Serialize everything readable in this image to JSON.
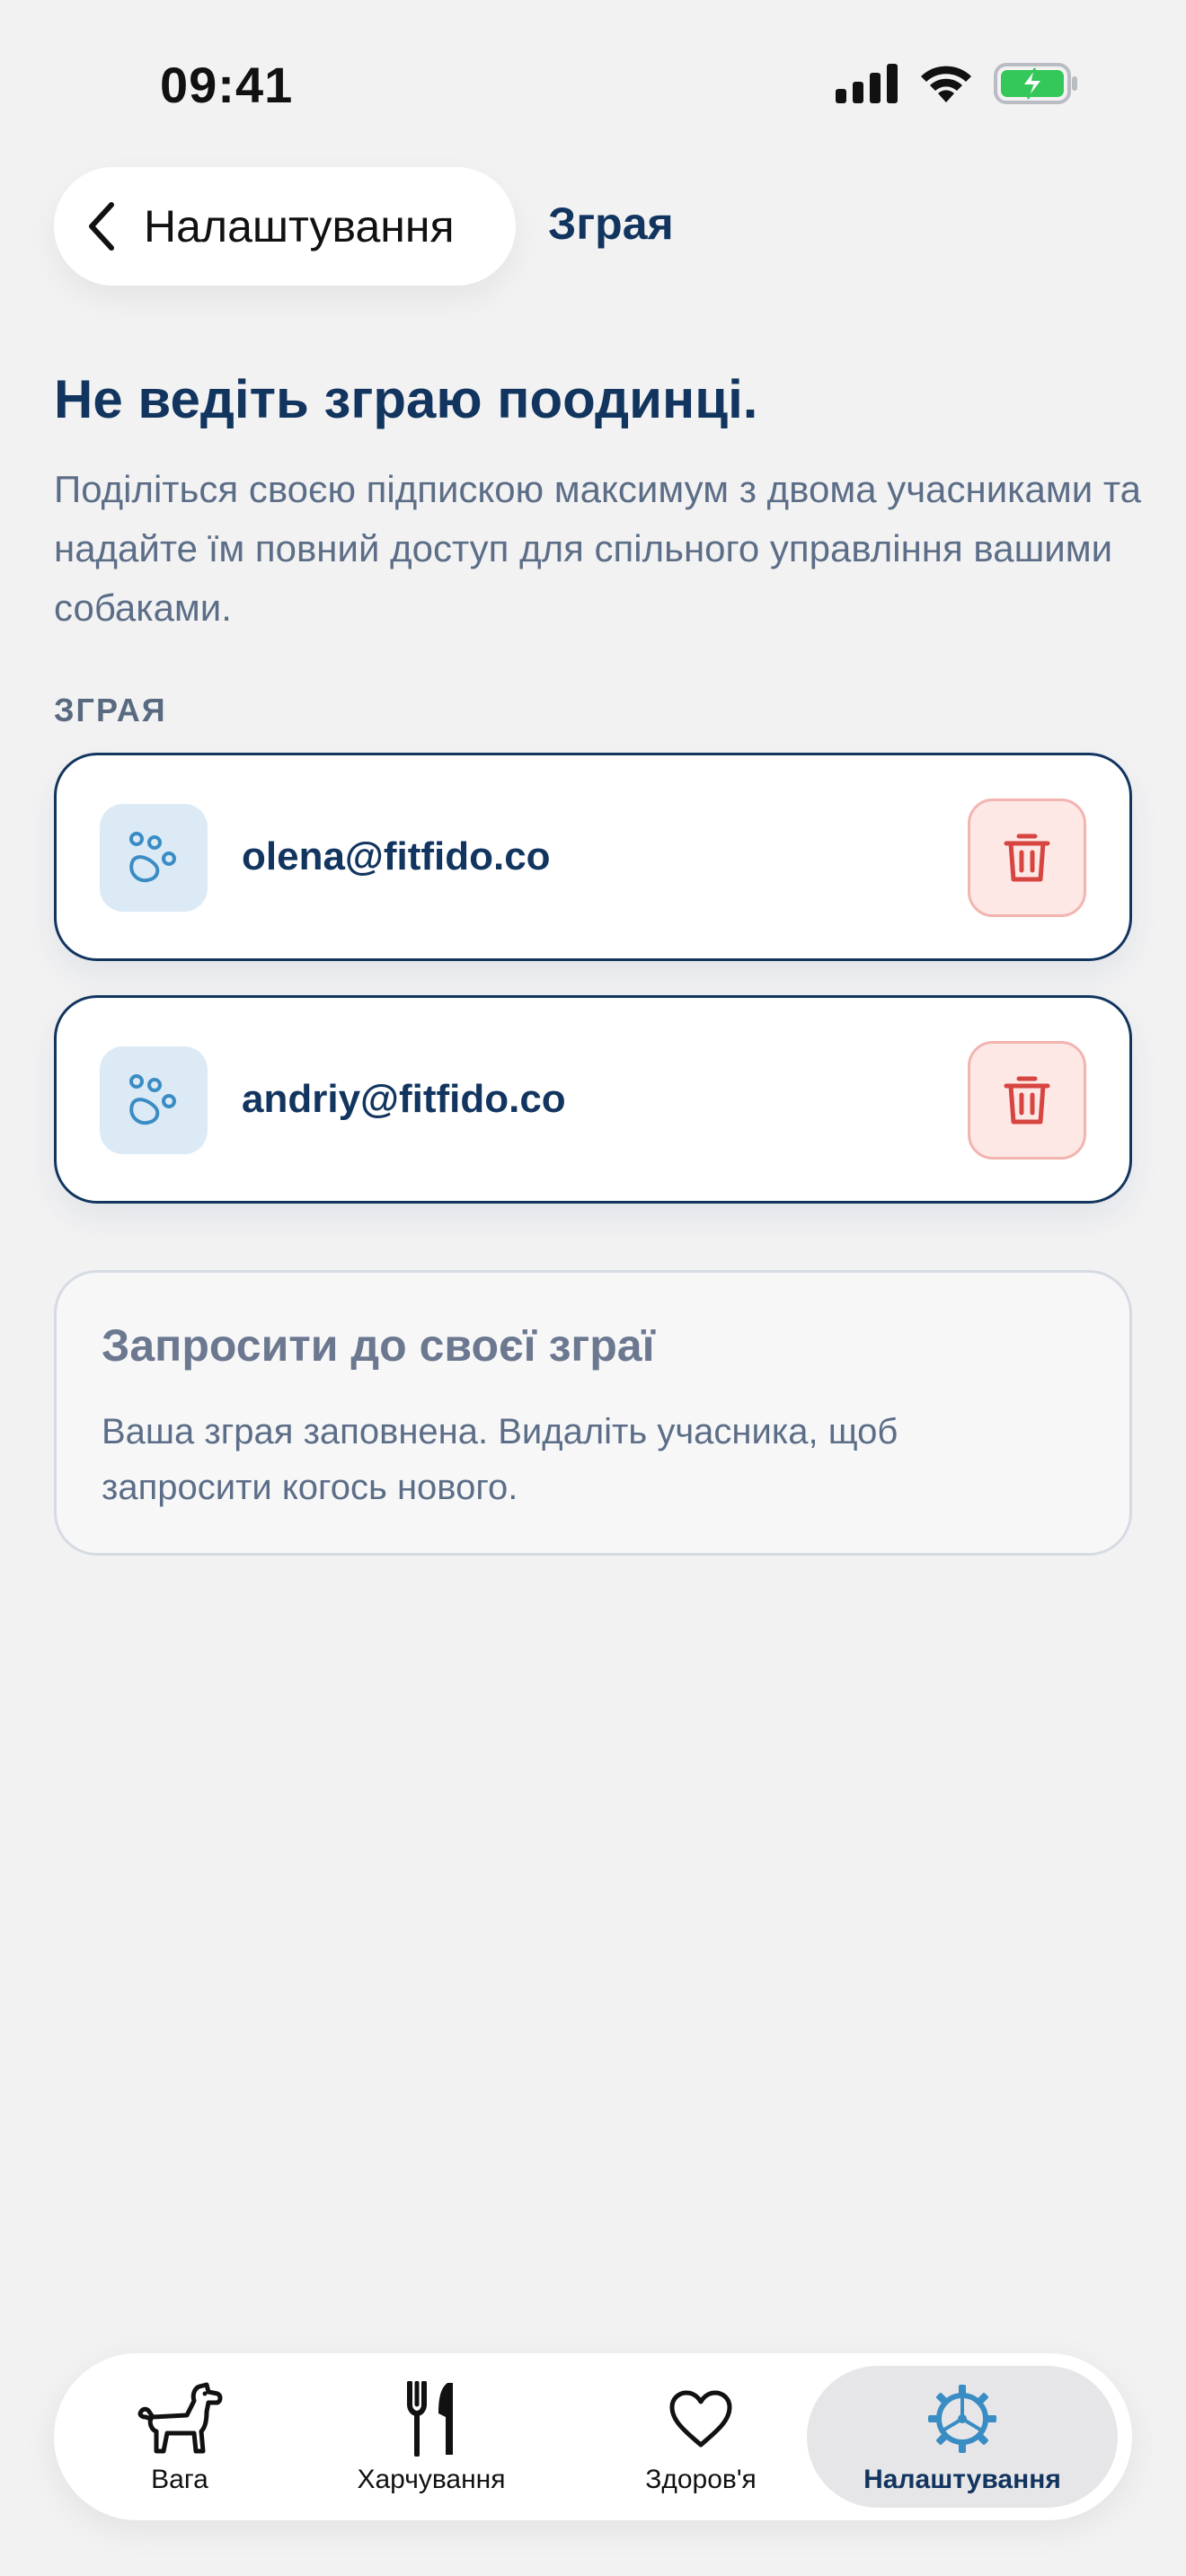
{
  "status_bar": {
    "time": "09:41"
  },
  "header": {
    "back_label": "Налаштування",
    "title": "Зграя"
  },
  "intro": {
    "title": "Не ведіть зграю поодинці.",
    "body": "Поділіться своєю підпискою максимум з двома учасниками та надайте їм повний доступ для спільного управління вашими собаками."
  },
  "pack": {
    "section_label": "ЗГРАЯ",
    "members": [
      {
        "email": "olena@fitfido.co"
      },
      {
        "email": "andriy@fitfido.co"
      }
    ]
  },
  "invite": {
    "title": "Запросити до своєї зграї",
    "description": "Ваша зграя заповнена. Видаліть учасника, щоб запросити когось нового."
  },
  "tabbar": {
    "tabs": [
      {
        "label": "Вага",
        "icon": "dog-icon"
      },
      {
        "label": "Харчування",
        "icon": "fork-knife-icon"
      },
      {
        "label": "Здоров'я",
        "icon": "heart-icon"
      },
      {
        "label": "Налаштування",
        "icon": "gear-icon",
        "active": true
      }
    ]
  },
  "colors": {
    "brand_navy": "#12355f",
    "accent_blue": "#3a8cc4",
    "danger_red": "#d64540",
    "battery_green": "#34c759"
  }
}
